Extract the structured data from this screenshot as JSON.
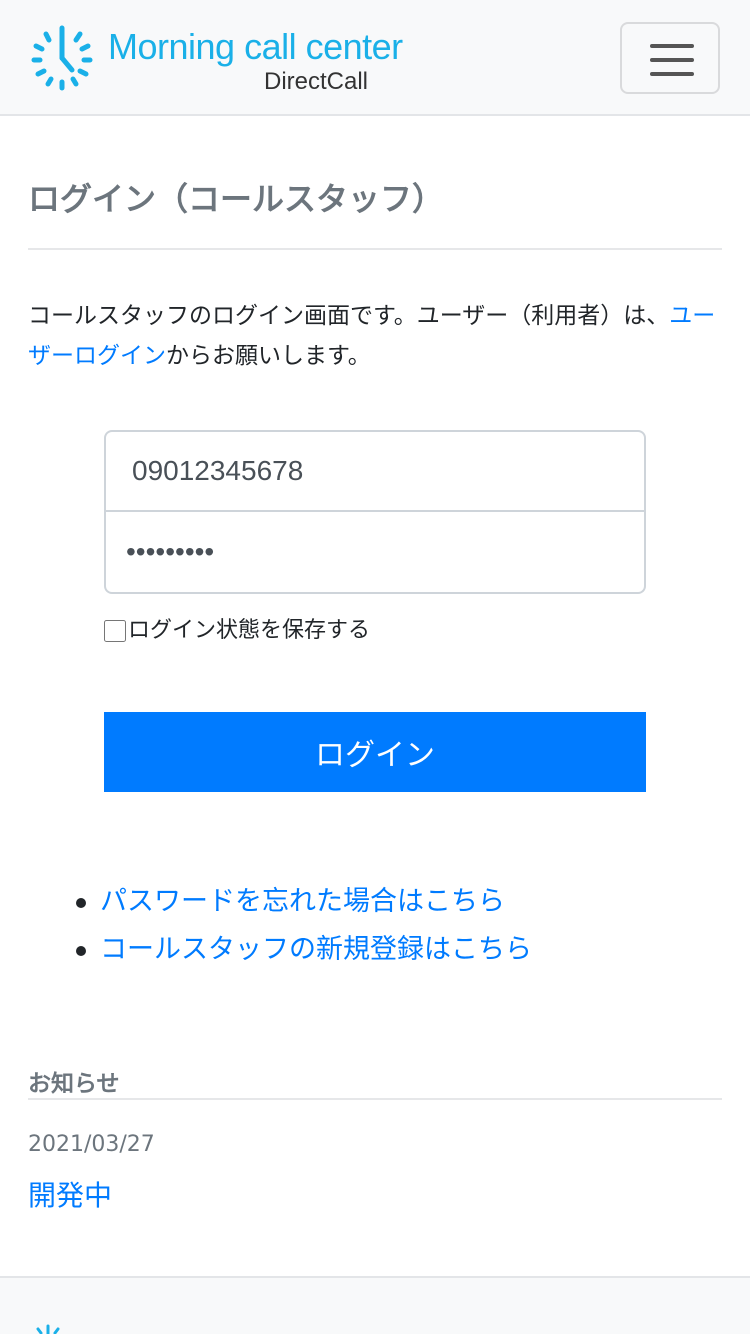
{
  "header": {
    "brand_title": "Morning call center",
    "brand_subtitle": "DirectCall",
    "menu_icon": "hamburger-icon",
    "brand_color": "#1ab0e8"
  },
  "main": {
    "title": "ログイン（コールスタッフ）",
    "intro_text": "コールスタッフのログイン画面です。ユーザー（利用者）は、",
    "intro_link": "ユーザーログイン",
    "intro_suffix": "からお願いします。",
    "form": {
      "phone_value": "09012345678",
      "password_value": "•••••••••",
      "remember_label": "ログイン状態を保存する",
      "remember_checked": false,
      "submit_label": "ログイン"
    },
    "links": [
      "パスワードを忘れた場合はこちら",
      "コールスタッフの新規登録はこちら"
    ]
  },
  "notices": {
    "heading": "お知らせ",
    "items": [
      {
        "date": "2021/03/27",
        "title": "開発中"
      }
    ]
  },
  "colors": {
    "primary": "#007bff",
    "muted": "#6c757d"
  }
}
